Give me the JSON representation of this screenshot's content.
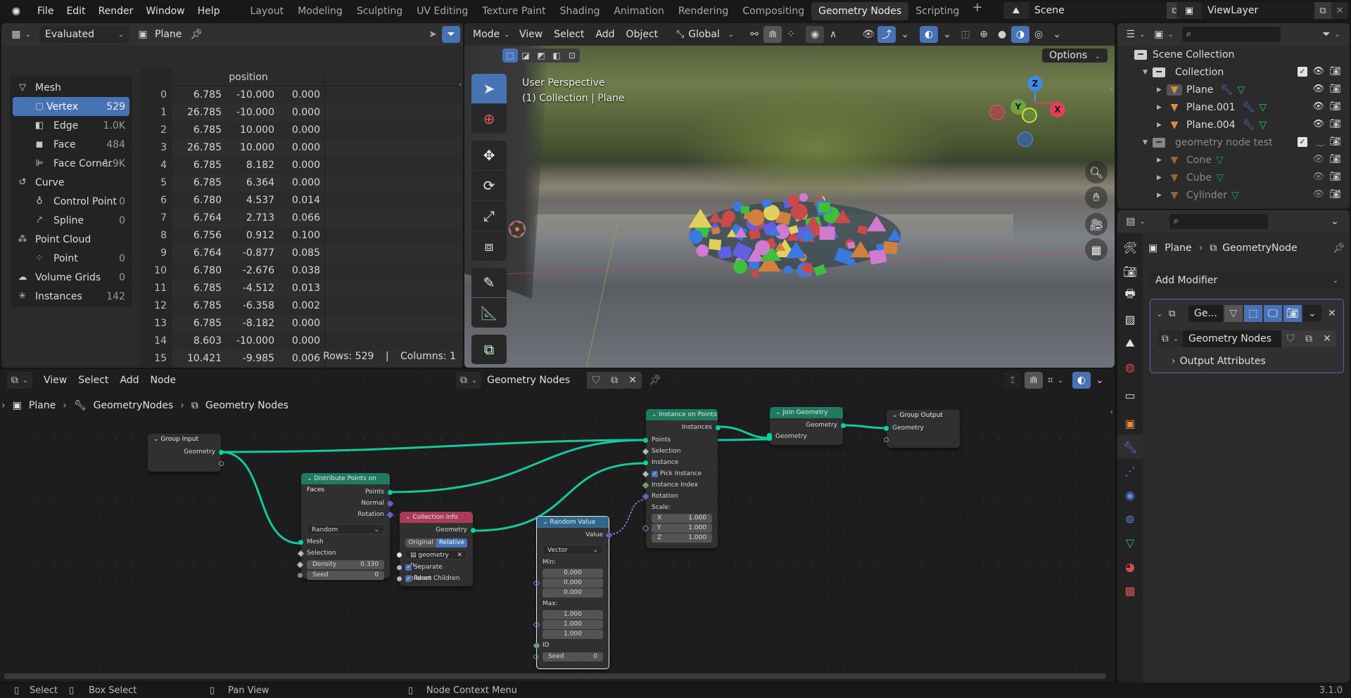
{
  "app": {
    "version": "3.1.0",
    "accent": "#4772b3"
  },
  "topbar": {
    "menus": [
      "File",
      "Edit",
      "Render",
      "Window",
      "Help"
    ],
    "workspaces": [
      "Layout",
      "Modeling",
      "Sculpting",
      "UV Editing",
      "Texture Paint",
      "Shading",
      "Animation",
      "Rendering",
      "Compositing",
      "Geometry Nodes",
      "Scripting"
    ],
    "active_workspace": "Geometry Nodes",
    "scene": "Scene",
    "view_layer": "ViewLayer"
  },
  "spreadsheet": {
    "display_mode": "Evaluated",
    "object": "Plane",
    "domains": [
      {
        "label": "Mesh",
        "count": "",
        "level": 1,
        "icon": "mesh-icon"
      },
      {
        "label": "Vertex",
        "count": "529",
        "level": 2,
        "icon": "vertex-icon",
        "selected": true
      },
      {
        "label": "Edge",
        "count": "1.0K",
        "level": 2,
        "icon": "edge-icon"
      },
      {
        "label": "Face",
        "count": "484",
        "level": 2,
        "icon": "face-icon"
      },
      {
        "label": "Face Corner",
        "count": "1.9K",
        "level": 2,
        "icon": "face-corner-icon"
      },
      {
        "label": "Curve",
        "count": "",
        "level": 1,
        "icon": "curve-icon"
      },
      {
        "label": "Control Point",
        "count": "0",
        "level": 2,
        "icon": "control-point-icon"
      },
      {
        "label": "Spline",
        "count": "0",
        "level": 2,
        "icon": "spline-icon"
      },
      {
        "label": "Point Cloud",
        "count": "",
        "level": 1,
        "icon": "point-cloud-icon"
      },
      {
        "label": "Point",
        "count": "0",
        "level": 2,
        "icon": "point-icon"
      },
      {
        "label": "Volume Grids",
        "count": "0",
        "level": 1,
        "icon": "volume-icon"
      },
      {
        "label": "Instances",
        "count": "142",
        "level": 1,
        "icon": "instances-icon"
      }
    ],
    "column_header": "position",
    "rows": [
      [
        "0",
        "6.785",
        "-10.000",
        "0.000"
      ],
      [
        "1",
        "26.785",
        "-10.000",
        "0.000"
      ],
      [
        "2",
        "6.785",
        "10.000",
        "0.000"
      ],
      [
        "3",
        "26.785",
        "10.000",
        "0.000"
      ],
      [
        "4",
        "6.785",
        "8.182",
        "0.000"
      ],
      [
        "5",
        "6.785",
        "6.364",
        "0.000"
      ],
      [
        "6",
        "6.780",
        "4.537",
        "0.014"
      ],
      [
        "7",
        "6.764",
        "2.713",
        "0.066"
      ],
      [
        "8",
        "6.756",
        "0.912",
        "0.100"
      ],
      [
        "9",
        "6.764",
        "-0.877",
        "0.085"
      ],
      [
        "10",
        "6.780",
        "-2.676",
        "0.038"
      ],
      [
        "11",
        "6.785",
        "-4.512",
        "0.013"
      ],
      [
        "12",
        "6.785",
        "-6.358",
        "0.002"
      ],
      [
        "13",
        "6.785",
        "-8.182",
        "0.000"
      ],
      [
        "14",
        "8.603",
        "-10.000",
        "0.000"
      ],
      [
        "15",
        "10.421",
        "-9.985",
        "0.006"
      ]
    ],
    "footer": {
      "rows": "Rows: 529",
      "sep": "|",
      "columns": "Columns: 1"
    }
  },
  "viewport": {
    "header": {
      "mode": "Mode",
      "menus": [
        "View",
        "Select",
        "Add",
        "Object"
      ],
      "orientation": "Global"
    },
    "options": "Options",
    "overlay_line1": "User Perspective",
    "overlay_line2": "(1) Collection | Plane",
    "gizmo": {
      "x": "X",
      "y": "Y",
      "z": "Z"
    }
  },
  "outliner": {
    "root": "Scene Collection",
    "items": [
      {
        "label": "Collection",
        "type": "collection",
        "indent": 1,
        "checked": true,
        "dim": false
      },
      {
        "label": "Plane",
        "type": "object",
        "indent": 2,
        "modifier": true,
        "dim": false,
        "active": true
      },
      {
        "label": "Plane.001",
        "type": "object",
        "indent": 2,
        "modifier": true,
        "dim": false
      },
      {
        "label": "Plane.004",
        "type": "object",
        "indent": 2,
        "modifier": true,
        "dim": false
      },
      {
        "label": "geometry node test",
        "type": "collection",
        "indent": 1,
        "checked": true,
        "dim": true
      },
      {
        "label": "Cone",
        "type": "object",
        "indent": 2,
        "modifier": false,
        "dim": true
      },
      {
        "label": "Cube",
        "type": "object",
        "indent": 2,
        "modifier": false,
        "dim": true
      },
      {
        "label": "Cylinder",
        "type": "object",
        "indent": 2,
        "modifier": false,
        "dim": true
      }
    ]
  },
  "properties": {
    "breadcrumb": [
      "Plane",
      "GeometryNode"
    ],
    "add_modifier": "Add Modifier",
    "modifier_name": "Ge...",
    "node_group": "Geometry Nodes",
    "output_attributes": "Output Attributes"
  },
  "node_editor": {
    "menus": [
      "View",
      "Select",
      "Add",
      "Node"
    ],
    "node_tree": "Geometry Nodes",
    "breadcrumb": [
      "Plane",
      "GeometryNodes",
      "Geometry Nodes"
    ],
    "nodes": {
      "group_input": {
        "title": "Group Input",
        "out": "Geometry"
      },
      "distribute": {
        "title": "Distribute Points on Faces",
        "outputs": [
          "Points",
          "Normal",
          "Rotation"
        ],
        "mode": "Random",
        "inputs": [
          "Mesh",
          "Selection"
        ],
        "density_label": "Density",
        "density": "0.330",
        "seed_label": "Seed",
        "seed": "0"
      },
      "collection_info": {
        "title": "Collection Info",
        "out": "Geometry",
        "opt_a": "Original",
        "opt_b": "Relative",
        "collection": "geometry n...",
        "sep_children": "Separate Children",
        "reset_children": "Reset Children"
      },
      "random_value": {
        "title": "Random Value",
        "out": "Value",
        "type": "Vector",
        "min_label": "Min:",
        "min": [
          "0.000",
          "0.000",
          "0.000"
        ],
        "max_label": "Max:",
        "max": [
          "1.000",
          "1.000",
          "1.000"
        ],
        "id": "ID",
        "seed_label": "Seed",
        "seed": "0"
      },
      "instance_on_points": {
        "title": "Instance on Points",
        "out": "Instances",
        "inputs": [
          "Points",
          "Selection",
          "Instance",
          "Pick Instance",
          "Instance Index",
          "Rotation"
        ],
        "scale_label": "Scale:",
        "scale": [
          [
            "X",
            "1.000"
          ],
          [
            "Y",
            "1.000"
          ],
          [
            "Z",
            "1.000"
          ]
        ]
      },
      "join_geometry": {
        "title": "Join Geometry",
        "out": "Geometry",
        "in": "Geometry"
      },
      "group_output": {
        "title": "Group Output",
        "in": "Geometry"
      }
    }
  },
  "statusbar": {
    "select": "Select",
    "box_select": "Box Select",
    "pan": "Pan View",
    "context": "Node Context Menu",
    "version": "3.1.0"
  }
}
